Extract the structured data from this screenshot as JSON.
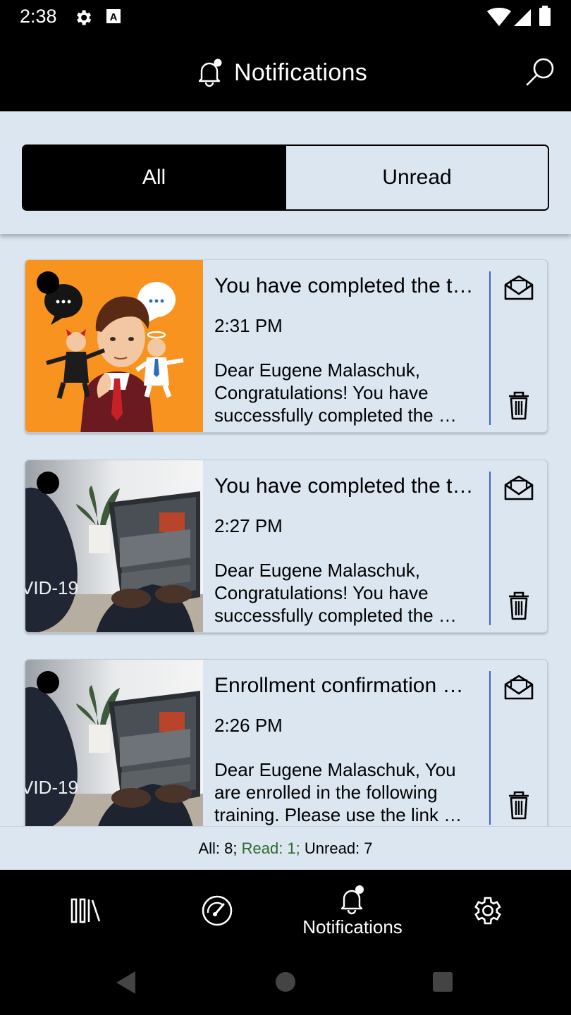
{
  "status_bar": {
    "time": "2:38",
    "icons": [
      "gear-icon",
      "font-app-icon",
      "wifi-icon",
      "cell-signal-icon",
      "battery-icon"
    ]
  },
  "app_bar": {
    "title": "Notifications",
    "icon": "bell-icon",
    "action_icon": "search-icon"
  },
  "filter": {
    "tabs": [
      {
        "label": "All",
        "selected": true
      },
      {
        "label": "Unread",
        "selected": false
      }
    ]
  },
  "notifications": [
    {
      "title": "You have completed the t…",
      "time": "2:31 PM",
      "message": "Dear Eugene Malaschuk, Congratulations! You have successfully completed the …",
      "thumbnail": "cartoon-businessman-thinking",
      "unread": true
    },
    {
      "title": "You have completed the t…",
      "time": "2:27 PM",
      "message": "Dear Eugene Malaschuk, Congratulations! You have successfully completed the …",
      "thumbnail": "laptop-covid-19-photo",
      "unread": true
    },
    {
      "title": "Enrollment confirmation …",
      "time": "2:26 PM",
      "message": "Dear Eugene Malaschuk, You are enrolled in the following training. Please use the link …",
      "thumbnail": "laptop-covid-19-photo",
      "unread": true
    }
  ],
  "thumb_text": "VID-19",
  "counts": {
    "all_label": "All: 8;",
    "read_label": "Read: 1;",
    "unread_label": "Unread: 7"
  },
  "bottom_nav": {
    "active_label": "Notifications",
    "items": [
      "library-icon",
      "dashboard-icon",
      "bell-icon",
      "settings-icon"
    ]
  },
  "colors": {
    "background": "#dbe6f1",
    "bar": "#000000",
    "divider_accent": "#3a66c4",
    "thumb_orange": "#f7931e",
    "read_count": "#2d6b2d"
  }
}
